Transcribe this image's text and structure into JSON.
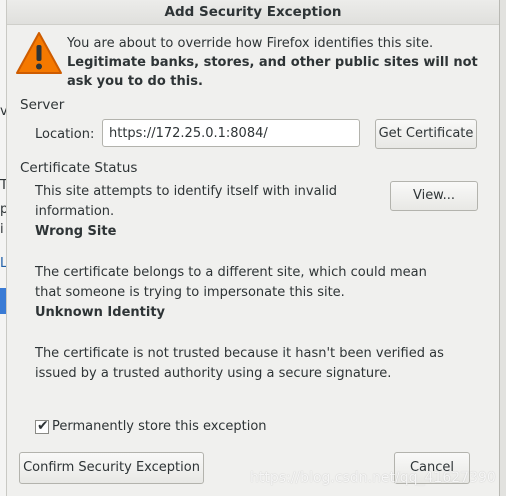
{
  "background_window": {
    "glyphs": [
      "v",
      "T",
      "p",
      "i",
      "L"
    ],
    "accent_color": "#3a7bd5"
  },
  "dialog": {
    "title": "Add Security Exception",
    "intro": {
      "line": "You are about to override how Firefox identifies this site.",
      "strong": "Legitimate banks, stores, and other public sites will not ask you to do this."
    },
    "server": {
      "title": "Server",
      "location_label": "Location:",
      "location_value": "https://172.25.0.1:8084/",
      "get_certificate_label": "Get Certificate"
    },
    "certificate_status": {
      "title": "Certificate Status",
      "description": "This site attempts to identify itself with invalid information.",
      "view_label": "View...",
      "wrong_site_title": "Wrong Site",
      "wrong_site_text": "The certificate belongs to a different site, which could mean that someone is trying to impersonate this site.",
      "unknown_identity_title": "Unknown Identity",
      "unknown_identity_text": "The certificate is not trusted because it hasn't been verified as issued by a trusted authority using a secure signature."
    },
    "permanent": {
      "label": "Permanently store this exception",
      "checked": true
    },
    "confirm_label": "Confirm Security Exception",
    "cancel_label": "Cancel"
  },
  "watermark": "https://blog.csdn.net/qq_41627390",
  "colors": {
    "warning_fill": "#f57900",
    "warning_border": "#ce5c00",
    "dialog_bg": "#f0f0ee"
  }
}
